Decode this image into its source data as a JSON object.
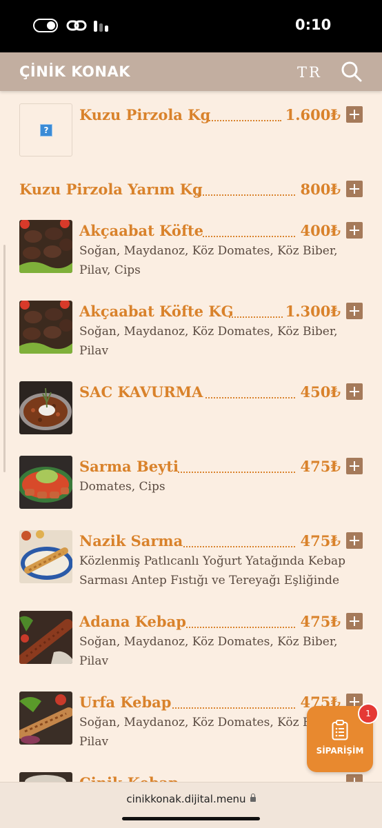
{
  "status_bar": {
    "time": "0:10"
  },
  "header": {
    "brand": "ÇİNİK KONAK",
    "language": "TR"
  },
  "menu_items": [
    {
      "name": "Kuzu Pirzola Kg",
      "price": "1.600₺",
      "description": "",
      "image": "placeholder"
    },
    {
      "name": "Kuzu Pirzola Yarım Kg",
      "price": "800₺",
      "description": "",
      "image": "none"
    },
    {
      "name": "Akçaabat Köfte",
      "price": "400₺",
      "description": "Soğan, Maydanoz, Köz Domates, Köz Biber, Pilav, Cips",
      "image": "kofte"
    },
    {
      "name": "Akçaabat Köfte KG",
      "price": "1.300₺",
      "description": "Soğan, Maydanoz, Köz Domates, Köz Biber, Pilav",
      "image": "kofte"
    },
    {
      "name": "SAC KAVURMA",
      "price": "450₺",
      "description": "",
      "image": "kavurma"
    },
    {
      "name": "Sarma Beyti",
      "price": "475₺",
      "description": "Domates, Cips",
      "image": "beyti"
    },
    {
      "name": "Nazik Sarma",
      "price": "475₺",
      "description": "Közlenmiş Patlıcanlı Yoğurt Yatağında Kebap Sarması Antep Fıstığı ve Tereyağı Eşliğinde",
      "image": "nazik"
    },
    {
      "name": "Adana Kebap",
      "price": "475₺",
      "description": "Soğan, Maydanoz, Köz Domates, Köz Biber, Pilav",
      "image": "adana"
    },
    {
      "name": "Urfa Kebap",
      "price": "475₺",
      "description": "Soğan, Maydanoz, Köz Domates, Köz Biber, Pilav",
      "image": "urfa"
    },
    {
      "name": "Çinik Kebap",
      "price": "",
      "description": "",
      "image": "partial"
    }
  ],
  "order_button": {
    "label": "SİPARİŞİM",
    "badge_count": "1"
  },
  "browser": {
    "url": "cinikkonak.dijital.menu"
  },
  "colors": {
    "accent": "#d9822b",
    "header_bg": "#c2aea0",
    "page_bg": "#fbeee2",
    "plus_bg": "#a57a5a",
    "order_bg": "#e8892f"
  }
}
